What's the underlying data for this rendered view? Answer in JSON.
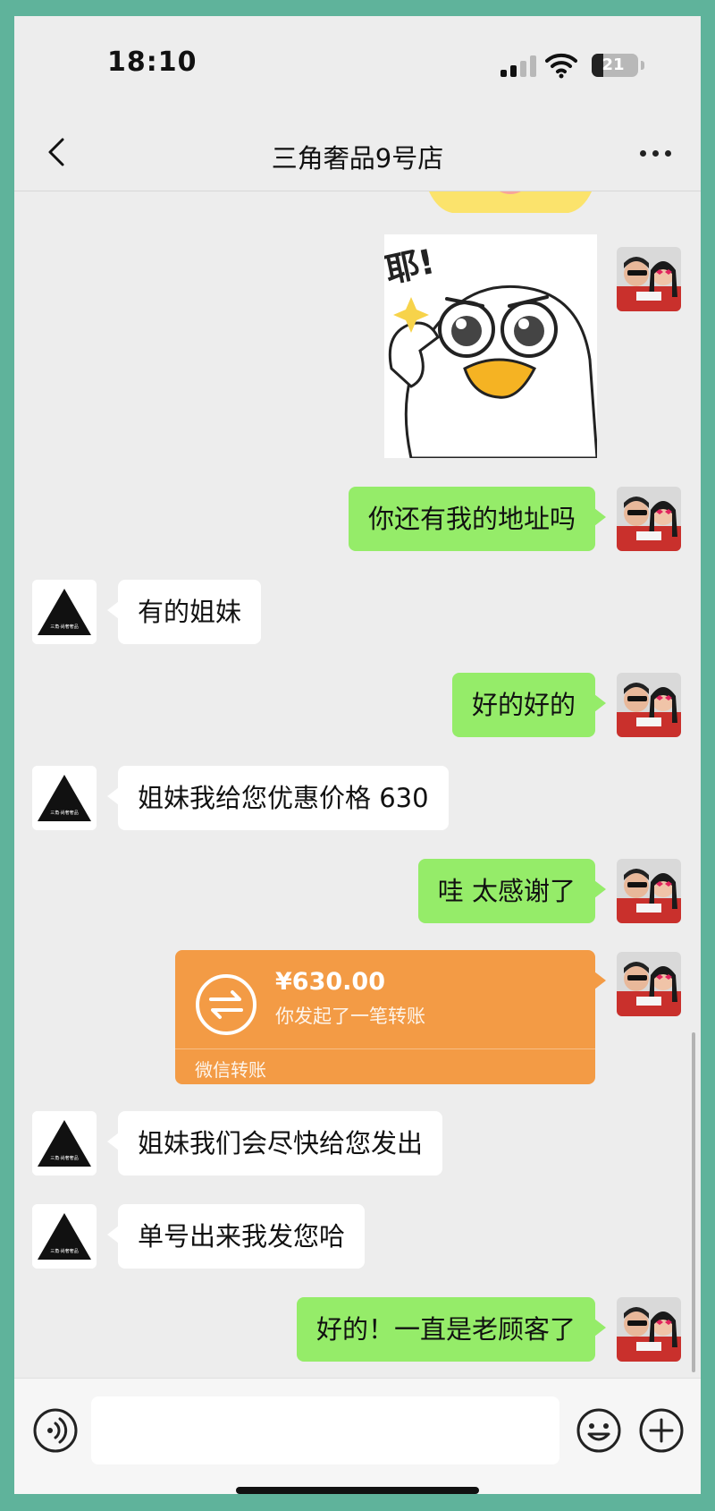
{
  "status_bar": {
    "time": "18:10",
    "battery": "21"
  },
  "nav": {
    "title": "三角奢品9号店"
  },
  "shop_avatar_text": "三角·尚奢奢品",
  "messages": [
    {
      "from": "me",
      "text": "你还有我的地址吗"
    },
    {
      "from": "shop",
      "text": "有的姐妹"
    },
    {
      "from": "me",
      "text": "好的好的"
    },
    {
      "from": "shop",
      "text": "姐妹我给您优惠价格 630"
    },
    {
      "from": "me",
      "text": "哇 太感谢了"
    },
    {
      "from": "shop",
      "text": "姐妹我们会尽快给您发出"
    },
    {
      "from": "shop",
      "text": "单号出来我发您哈"
    },
    {
      "from": "me",
      "text": "好的！一直是老顾客了"
    }
  ],
  "sticker": {
    "text": "耶!"
  },
  "transfer": {
    "amount": "¥630.00",
    "description": "你发起了一笔转账",
    "label": "微信转账"
  },
  "colors": {
    "me_bubble": "#95ec69",
    "shop_bubble": "#ffffff",
    "transfer": "#f39b45",
    "background": "#ededed"
  }
}
